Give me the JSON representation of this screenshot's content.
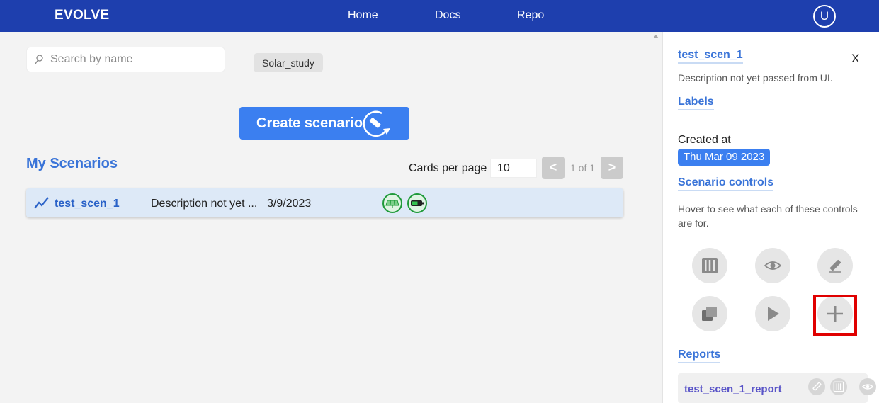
{
  "header": {
    "brand": "EVOLVE",
    "nav": [
      "Home",
      "Docs",
      "Repo"
    ],
    "avatar_initial": "U",
    "bar_color": "#1e3fae"
  },
  "main": {
    "search": {
      "placeholder": "Search by name",
      "value": ""
    },
    "tag": "Solar_study",
    "create_button": "Create scenario",
    "section_title": "My Scenarios",
    "cards_per_page_label": "Cards per page",
    "cards_per_page_value": "10",
    "pagination": {
      "prev": "<",
      "next": ">",
      "info": "1 of 1"
    },
    "scenarios": [
      {
        "name": "test_scen_1",
        "description": "Description not yet ...",
        "date": "3/9/2023",
        "icons": [
          "solar-panel-icon",
          "battery-icon"
        ]
      }
    ]
  },
  "panel": {
    "title": "test_scen_1",
    "close": "X",
    "description": "Description not yet passed from UI.",
    "labels_heading": "Labels",
    "created_label": "Created at",
    "created_date": "Thu Mar 09 2023",
    "controls_heading": "Scenario controls",
    "controls_hint": "Hover to see what each of these controls are for.",
    "controls": [
      "columns-icon",
      "eye-icon",
      "pencil-icon",
      "copy-icon",
      "play-icon",
      "plus-icon"
    ],
    "reports_heading": "Reports",
    "reports": [
      {
        "name": "test_scen_1_report",
        "actions": [
          "pencil-icon",
          "columns-icon",
          "eye-icon"
        ]
      }
    ]
  },
  "accent_color": "#3b7ff0"
}
